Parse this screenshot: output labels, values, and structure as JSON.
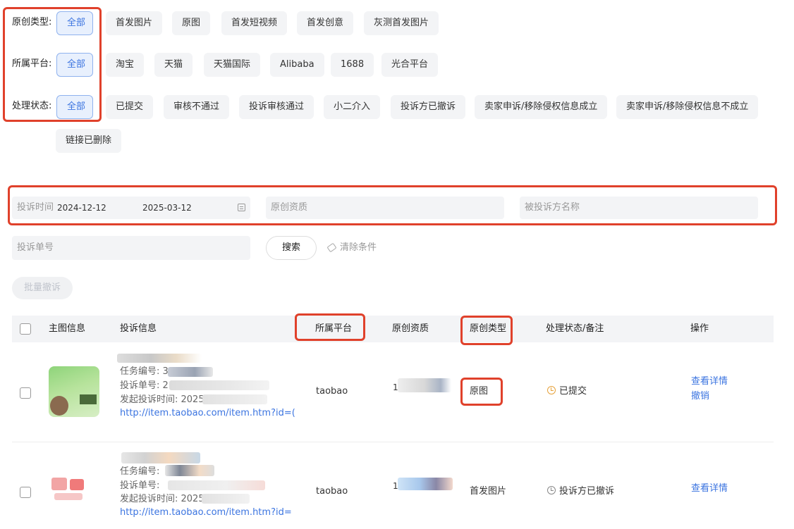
{
  "filters": {
    "original_type": {
      "label": "原创类型:",
      "options": [
        "全部",
        "首发图片",
        "原图",
        "首发短视频",
        "首发创意",
        "灰测首发图片"
      ],
      "selected": "全部"
    },
    "platform": {
      "label": "所属平台:",
      "options": [
        "全部",
        "淘宝",
        "天猫",
        "天猫国际",
        "Alibaba",
        "1688",
        "光合平台"
      ],
      "selected": "全部"
    },
    "status": {
      "label": "处理状态:",
      "options": [
        "全部",
        "已提交",
        "审核不通过",
        "投诉审核通过",
        "小二介入",
        "投诉方已撤诉",
        "卖家申诉/移除侵权信息成立",
        "卖家申诉/移除侵权信息不成立",
        "链接已删除"
      ],
      "selected": "全部"
    }
  },
  "search": {
    "complaint_time_label": "投诉时间",
    "date_start": "2024-12-12",
    "date_end": "2025-03-12",
    "original_credential_placeholder": "原创资质",
    "respondent_placeholder": "被投诉方名称",
    "complaint_no_placeholder": "投诉单号",
    "search_button": "搜索",
    "clear_button": "清除条件",
    "batch_withdraw": "批量撤诉"
  },
  "table": {
    "headers": [
      "主图信息",
      "投诉信息",
      "所属平台",
      "原创资质",
      "原创类型",
      "处理状态/备注",
      "操作"
    ],
    "rows": [
      {
        "task_label": "任务编号: 3",
        "complaint_label": "投诉单号: 2",
        "time_label": "发起投诉时间: 2025",
        "url": "http://item.taobao.com/item.htm?id=(",
        "platform": "taobao",
        "credential": "1",
        "type": "原图",
        "status": "已提交",
        "actions": [
          "查看详情",
          "撤销"
        ]
      },
      {
        "task_label": "任务编号: ",
        "complaint_label": "投诉单号: ",
        "time_label": "发起投诉时间: 2025",
        "url": "http://item.taobao.com/item.htm?id=",
        "platform": "taobao",
        "credential": "1",
        "type": "首发图片",
        "status": "投诉方已撤诉",
        "actions": [
          "查看详情"
        ]
      }
    ]
  },
  "colors": {
    "accent": "#3b74e0",
    "highlight_border": "#e0412b",
    "chip_bg": "#f3f4f6"
  }
}
